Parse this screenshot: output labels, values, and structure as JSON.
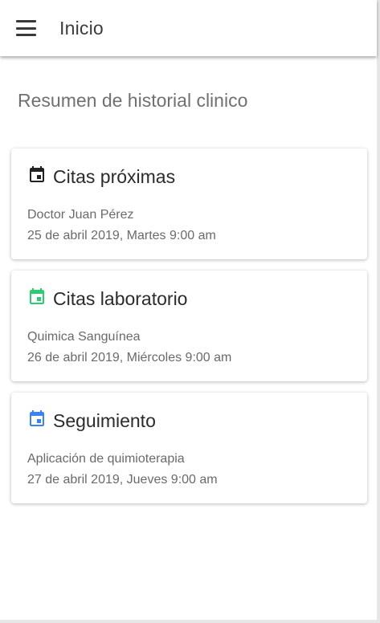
{
  "appbar": {
    "title": "Inicio",
    "menu_icon": "hamburger-menu-icon"
  },
  "section": {
    "title": "Resumen de historial clinico"
  },
  "cards": [
    {
      "title": "Citas próximas",
      "icon": "calendar-event-icon",
      "icon_color": "#222222",
      "line1": "Doctor Juan Pérez",
      "line2": "25 de abril 2019, Martes 9:00 am"
    },
    {
      "title": "Citas laboratorio",
      "icon": "calendar-event-icon",
      "icon_color": "#2ecc71",
      "line1": "Quimica Sanguínea",
      "line2": "26 de abril 2019, Miércoles 9:00 am"
    },
    {
      "title": "Seguimiento",
      "icon": "calendar-event-icon",
      "icon_color": "#3b82f6",
      "line1": "Aplicación de quimioterapia",
      "line2": "27 de abril 2019, Jueves 9:00 am"
    }
  ]
}
